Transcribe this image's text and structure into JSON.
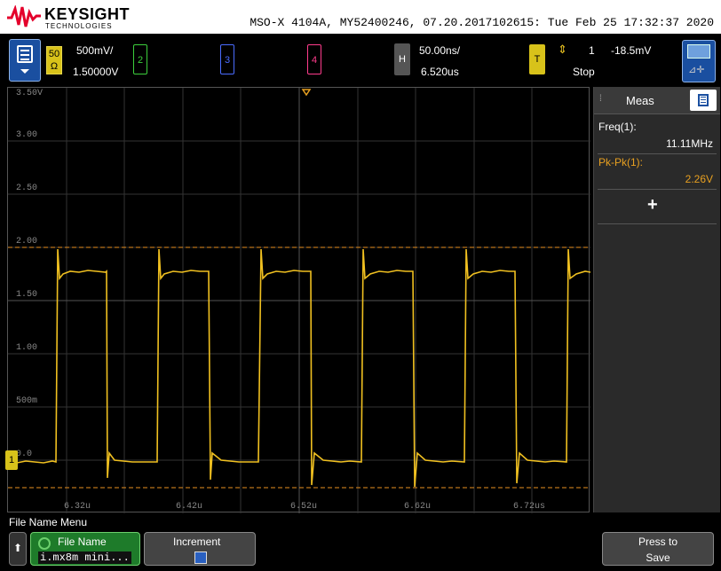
{
  "header": {
    "brand": "KEYSIGHT",
    "brand_sub": "TECHNOLOGIES",
    "info": "MSO-X 4104A, MY52400246, 07.20.2017102615: Tue Feb 25 17:32:37 2020"
  },
  "channel1": {
    "impedance_top": "50",
    "impedance_bottom": "Ω",
    "scale": "500mV/",
    "offset": "1.50000V",
    "color": "#e8c020"
  },
  "channels": [
    {
      "label": "2",
      "color": "#3ccf3c"
    },
    {
      "label": "3",
      "color": "#4a6cff"
    },
    {
      "label": "4",
      "color": "#ff3c8c"
    }
  ],
  "horizontal": {
    "label": "H",
    "scale": "50.00ns/",
    "delay": "6.520us"
  },
  "trigger": {
    "label": "T",
    "edge_icon": "rising-falling-edge-icon",
    "edge_glyph": "⇕",
    "source": "1",
    "level": "-18.5mV",
    "mode": "Stop"
  },
  "grid": {
    "voltage_labels": [
      "3.50V",
      "3.00",
      "2.50",
      "2.00",
      "1.50",
      "1.00",
      "500m",
      "0.0"
    ],
    "time_labels": [
      "6.32u",
      "6.42u",
      "6.52u",
      "6.62u",
      "6.72us"
    ],
    "ground_marker": "1",
    "trigger_marker": "T"
  },
  "measurements": {
    "title": "Meas",
    "items": [
      {
        "label": "Freq(1):",
        "value": "11.11MHz",
        "color": "#ffffff"
      },
      {
        "label": "Pk-Pk(1):",
        "value": "2.26V",
        "color": "#e8a020"
      }
    ],
    "add_label": "+"
  },
  "softkeys": {
    "menu_title": "File Name Menu",
    "back_glyph": "⬆",
    "file_name_label": "File Name",
    "file_name_value": "i.mx8m mini...",
    "increment_label": "Increment",
    "increment_checked": true,
    "press_to": "Press to",
    "save": "Save"
  }
}
